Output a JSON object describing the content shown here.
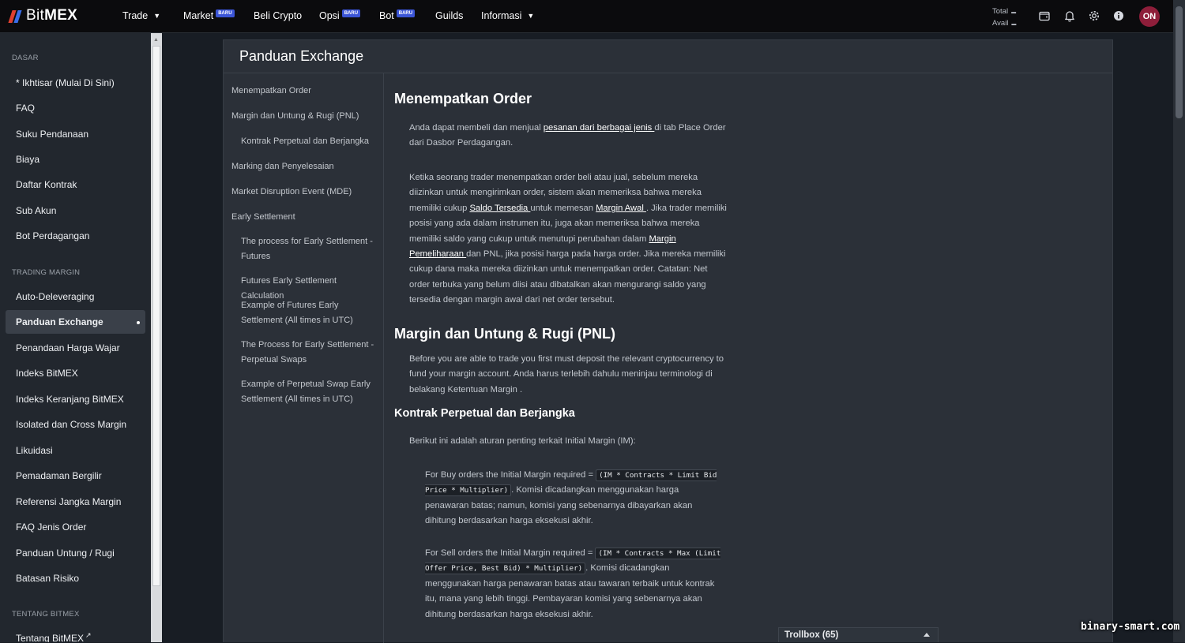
{
  "brand": {
    "logo_text_light": "Bit",
    "logo_text_bold": "MEX"
  },
  "topnav": {
    "items": [
      {
        "label": "Trade",
        "has_caret": true
      },
      {
        "label": "Market",
        "badge": "BARU"
      },
      {
        "label": "Beli Crypto"
      },
      {
        "label": "Opsi",
        "badge": "BARU"
      },
      {
        "label": "Bot",
        "badge": "BARU"
      },
      {
        "label": "Guilds"
      },
      {
        "label": "Informasi",
        "has_caret": true
      }
    ],
    "balance": {
      "total_label": "Total",
      "avail_label": "Avail"
    },
    "icons": [
      "wallet-icon",
      "bell-icon",
      "gear-icon",
      "info-icon"
    ],
    "avatar_initials": "ON"
  },
  "sidebar": {
    "sections": [
      {
        "title": "DASAR",
        "items": [
          "* Ikhtisar (Mulai Di Sini)",
          "FAQ",
          "Suku Pendanaan",
          "Biaya",
          "Daftar Kontrak",
          "Sub Akun",
          "Bot Perdagangan"
        ]
      },
      {
        "title": "TRADING MARGIN",
        "items": [
          "Auto-Deleveraging",
          "Panduan Exchange",
          "Penandaan Harga Wajar",
          "Indeks BitMEX",
          "Indeks Keranjang BitMEX",
          "Isolated dan Cross Margin",
          "Likuidasi",
          "Pemadaman Bergilir",
          "Referensi Jangka Margin",
          "FAQ Jenis Order",
          "Panduan Untung / Rugi",
          "Batasan Risiko"
        ]
      },
      {
        "title": "TENTANG BITMEX",
        "items": [
          "Tentang BitMEX"
        ]
      }
    ],
    "active_item": "Panduan Exchange"
  },
  "panel": {
    "title": "Panduan Exchange",
    "toc": [
      "Menempatkan Order",
      "Margin dan Untung & Rugi (PNL)",
      "Kontrak Perpetual dan Berjangka",
      "Marking dan Penyelesaian",
      "Market Disruption Event (MDE)",
      "Early Settlement",
      "The process for Early Settlement - Futures",
      "Futures Early Settlement Calculation",
      "Example of Futures Early Settlement (All times in UTC)",
      "The Process for Early Settlement - Perpetual Swaps",
      "Example of Perpetual Swap Early Settlement (All times in UTC)"
    ],
    "article": {
      "h_place_order": "Menempatkan Order",
      "p1_before": "Anda dapat membeli dan menjual ",
      "p1_link": "pesanan dari berbagai jenis ",
      "p1_after": "di tab Place Order dari Dasbor Perdagangan.",
      "p2_a": "Ketika seorang trader menempatkan order beli atau jual, sebelum mereka diizinkan untuk mengirimkan order, sistem akan memeriksa bahwa mereka memiliki cukup ",
      "p2_link1": "Saldo Tersedia ",
      "p2_b": "untuk memesan ",
      "p2_link2": "Margin Awal ",
      "p2_c": ". Jika trader memiliki posisi yang ada dalam instrumen itu, juga akan memeriksa bahwa mereka memiliki saldo yang cukup untuk menutupi perubahan dalam ",
      "p2_link3": "Margin Pemeliharaan ",
      "p2_d": "dan PNL, jika posisi harga pada harga order. Jika mereka memiliki cukup dana maka mereka diizinkan untuk menempatkan order. Catatan: Net order terbuka yang belum diisi atau dibatalkan akan mengurangi saldo yang tersedia dengan margin awal dari net order tersebut.",
      "h_margin": "Margin dan Untung & Rugi (PNL)",
      "p3": "Before you are able to trade you first must deposit the relevant cryptocurrency to fund your margin account. Anda harus terlebih dahulu meninjau terminologi di belakang Ketentuan Margin .",
      "h_perp": "Kontrak Perpetual dan Berjangka",
      "p4": "Berikut ini adalah aturan penting terkait Initial Margin (IM):",
      "p5_a": "For Buy orders the Initial Margin required = ",
      "p5_code": "(IM * Contracts * Limit Bid Price * Multiplier)",
      "p5_b": ". Komisi dicadangkan menggunakan harga penawaran batas; namun, komisi yang sebenarnya dibayarkan akan dihitung berdasarkan harga eksekusi akhir.",
      "p6_a": "For Sell orders the Initial Margin required = ",
      "p6_code": "(IM * Contracts * Max (Limit Offer Price, Best Bid) * Multiplier)",
      "p6_b": ". Komisi dicadangkan menggunakan harga penawaran batas atau tawaran terbaik untuk kontrak itu, mana yang lebih tinggi. Pembayaran komisi yang sebenarnya akan dihitung berdasarkan harga eksekusi akhir."
    }
  },
  "trollbox": {
    "label": "Trollbox (65)"
  },
  "watermark": "binary-smart.com"
}
